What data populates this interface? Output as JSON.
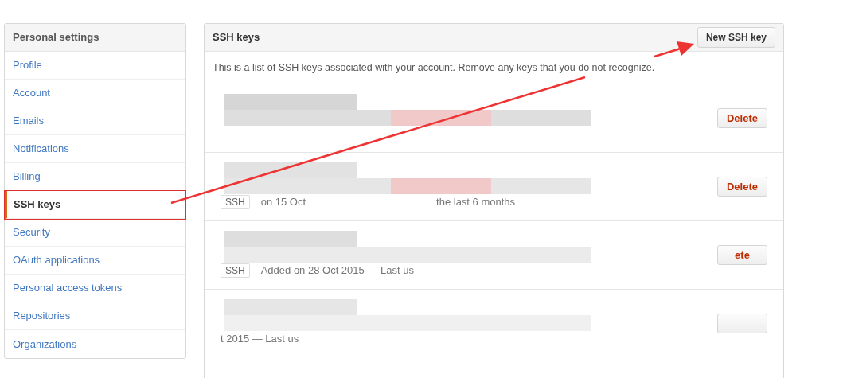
{
  "sidebar": {
    "title": "Personal settings",
    "items": [
      {
        "label": "Profile",
        "selected": false
      },
      {
        "label": "Account",
        "selected": false
      },
      {
        "label": "Emails",
        "selected": false
      },
      {
        "label": "Notifications",
        "selected": false
      },
      {
        "label": "Billing",
        "selected": false
      },
      {
        "label": "SSH keys",
        "selected": true
      },
      {
        "label": "Security",
        "selected": false
      },
      {
        "label": "OAuth applications",
        "selected": false
      },
      {
        "label": "Personal access tokens",
        "selected": false
      },
      {
        "label": "Repositories",
        "selected": false
      },
      {
        "label": "Organizations",
        "selected": false
      }
    ]
  },
  "panel": {
    "title": "SSH keys",
    "new_button": "New SSH key",
    "description": "This is a list of SSH keys associated with your account. Remove any keys that you do not recognize.",
    "keys": [
      {
        "delete_label": "Delete"
      },
      {
        "badge": "SSH",
        "meta": [
          "on 15 Oct",
          "the last 6 months"
        ],
        "delete_label": "Delete"
      },
      {
        "badge": "SSH",
        "meta": [
          "Added on 28 Oct 2015 — Last us"
        ],
        "delete_label": "ete"
      },
      {
        "meta": [
          "t 2015 — Last us"
        ],
        "delete_button": true
      }
    ]
  }
}
